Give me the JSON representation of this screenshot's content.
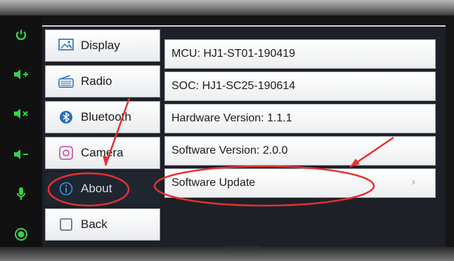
{
  "menu": {
    "items": [
      {
        "label": "Display",
        "icon": "display-icon"
      },
      {
        "label": "Radio",
        "icon": "radio-icon"
      },
      {
        "label": "Bluetooth",
        "icon": "bluetooth-icon"
      },
      {
        "label": "Camera",
        "icon": "camera-icon"
      },
      {
        "label": "About",
        "icon": "info-icon",
        "selected": true
      },
      {
        "label": "Back",
        "icon": "checkbox-icon"
      }
    ]
  },
  "about": {
    "mcu": "MCU: HJ1-ST01-190419",
    "soc": "SOC: HJ1-SC25-190614",
    "hardware_version": "Hardware Version: 1.1.1",
    "software_version": "Software Version: 2.0.0",
    "software_update": "Software Update",
    "chevron": "›"
  },
  "side_keys": [
    "power-icon",
    "volume-up-icon",
    "mute-icon",
    "volume-down-icon",
    "microphone-icon",
    "home-icon"
  ],
  "brand": "JENSEN",
  "colors": {
    "accent": "#35d24a",
    "annotation": "#e53030",
    "selected_bg": "#1f2630"
  }
}
